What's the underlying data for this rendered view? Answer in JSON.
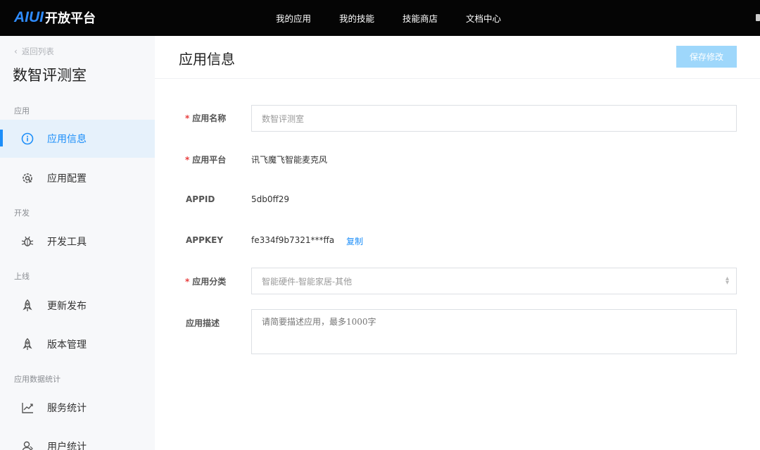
{
  "topbar": {
    "logo_mark": "AIUI",
    "logo_text": "开放平台",
    "nav": [
      "我的应用",
      "我的技能",
      "技能商店",
      "文档中心"
    ]
  },
  "sidebar": {
    "back_label": "返回列表",
    "app_title": "数智评测室",
    "sections": {
      "app": "应用",
      "dev": "开发",
      "release": "上线",
      "stats": "应用数据统计"
    },
    "items": [
      {
        "label": "应用信息",
        "icon": "info-icon",
        "active": true
      },
      {
        "label": "应用配置",
        "icon": "gear-icon",
        "active": false
      },
      {
        "label": "开发工具",
        "icon": "bug-icon",
        "active": false
      },
      {
        "label": "更新发布",
        "icon": "rocket-icon",
        "active": false
      },
      {
        "label": "版本管理",
        "icon": "rocket-icon",
        "active": false
      },
      {
        "label": "服务统计",
        "icon": "trend-chart-icon",
        "active": false
      },
      {
        "label": "用户统计",
        "icon": "user-icon",
        "active": false
      }
    ]
  },
  "main": {
    "title": "应用信息",
    "save_label": "保存修改",
    "required_mark": "*",
    "fields": {
      "name": {
        "label": "应用名称",
        "value": "数智评测室"
      },
      "platform": {
        "label": "应用平台",
        "value": "讯飞魔飞智能麦克风"
      },
      "appid": {
        "label": "APPID",
        "value": "5db0ff29"
      },
      "appkey": {
        "label": "APPKEY",
        "value": "fe334f9b7321***ffa",
        "copy_label": "复制"
      },
      "category": {
        "label": "应用分类",
        "value": "智能硬件-智能家居-其他"
      },
      "description": {
        "label": "应用描述",
        "placeholder": "请简要描述应用，最多1000字"
      }
    }
  },
  "colors": {
    "accent": "#1c8ef9",
    "topbar_bg": "#050505",
    "sidebar_bg": "#f7f8fa",
    "active_bg": "#e6f1fb",
    "save_btn_bg": "#9ed7fb",
    "required": "#e83d3d"
  }
}
